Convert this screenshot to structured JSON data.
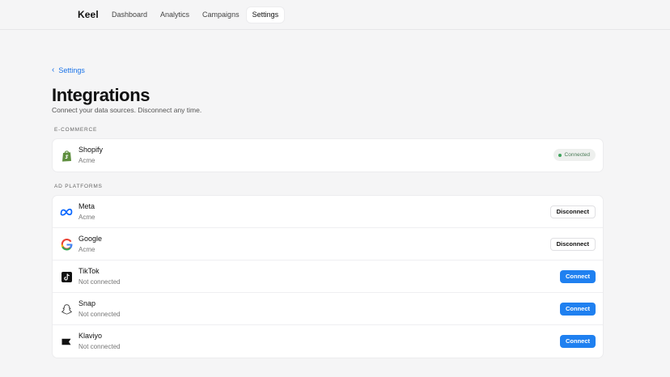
{
  "app": {
    "brand": "Keel"
  },
  "nav": {
    "tabs": [
      {
        "label": "Dashboard"
      },
      {
        "label": "Analytics"
      },
      {
        "label": "Campaigns"
      },
      {
        "label": "Settings",
        "active": true
      }
    ]
  },
  "breadcrumb": {
    "back_label": "Settings"
  },
  "page": {
    "title": "Integrations",
    "subtitle": "Connect your data sources. Disconnect any time."
  },
  "sections": {
    "ecommerce": {
      "label": "E-COMMERCE",
      "items": [
        {
          "name": "Shopify",
          "sub": "Acme",
          "status": "Connected",
          "icon": "shopify-icon"
        }
      ]
    },
    "ad_platforms": {
      "label": "AD PLATFORMS",
      "items": [
        {
          "name": "Meta",
          "sub": "Acme",
          "action": "Disconnect",
          "icon": "meta-icon"
        },
        {
          "name": "Google",
          "sub": "Acme",
          "action": "Disconnect",
          "icon": "google-icon"
        },
        {
          "name": "TikTok",
          "sub": "Not connected",
          "action": "Connect",
          "icon": "tiktok-icon"
        },
        {
          "name": "Snap",
          "sub": "Not connected",
          "action": "Connect",
          "icon": "snapchat-icon"
        },
        {
          "name": "Klaviyo",
          "sub": "Not connected",
          "action": "Connect",
          "icon": "klaviyo-icon"
        }
      ]
    }
  },
  "colors": {
    "accent": "#1f80f0",
    "connected_text": "#4a7b57",
    "connected_dot": "#3fa45d",
    "background": "#f5f5f6"
  }
}
